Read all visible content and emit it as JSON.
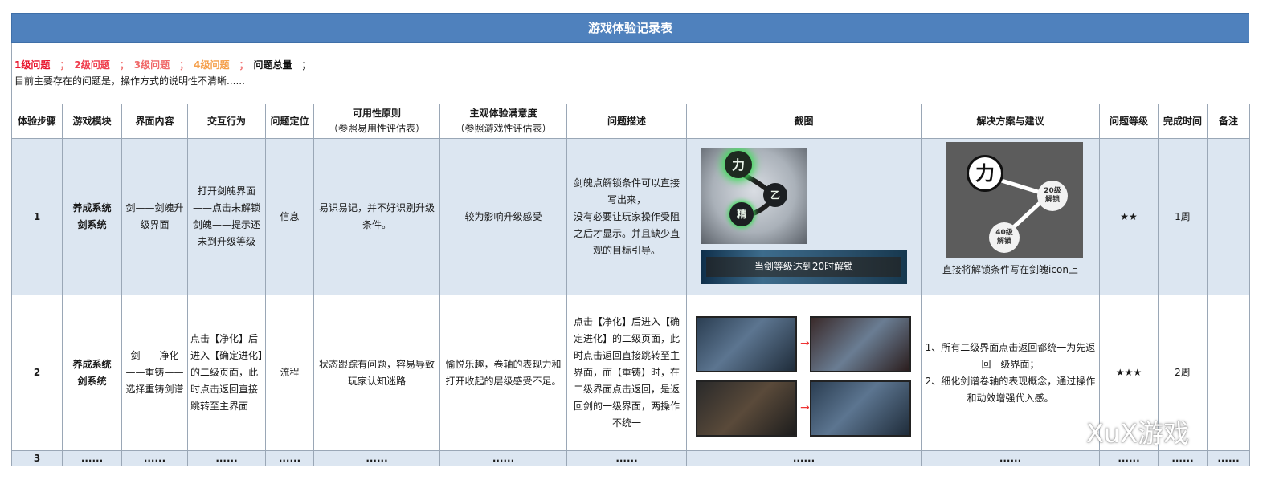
{
  "title": "游戏体验记录表",
  "summary": {
    "level1": "1级问题",
    "level2": "2级问题",
    "level3": "3级问题",
    "level4": "4级问题",
    "separator": "；",
    "total_label": "问题总量",
    "total_end": "；",
    "note": "目前主要存在的问题是，操作方式的说明性不清晰......"
  },
  "headers": {
    "step": "体验步骤",
    "module": "游戏模块",
    "content": "界面内容",
    "action": "交互行为",
    "position": "问题定位",
    "usability": "可用性原则",
    "usability_sub": "（参照易用性评估表）",
    "satisfaction": "主观体验满意度",
    "satisfaction_sub": "（参照游戏性评估表）",
    "description": "问题描述",
    "screenshot": "截图",
    "solution": "解决方案与建议",
    "level": "问题等级",
    "time": "完成时间",
    "remark": "备注"
  },
  "rows": [
    {
      "step": "1",
      "module": "养成系统\n剑系统",
      "content": "剑——剑魄升级界面",
      "action": "打开剑魄界面——点击未解锁剑魄——提示还未到升级等级",
      "position": "信息",
      "usability": "易识易记，并不好识别升级条件。",
      "satisfaction": "较为影响升级感受",
      "description": "剑魄点解锁条件可以直接写出来，\n没有必要让玩家操作受阻之后才显示。并且缺少直观的目标引导。",
      "screenshot_banner": "当剑等级达到20时解锁",
      "screenshot_orbs": [
        "力",
        "乙",
        "精"
      ],
      "solution_caption": "直接将解锁条件写在剑魄icon上",
      "solution_orbs": {
        "main": "力",
        "node1_level": "20级",
        "node1_text": "解锁",
        "node2_level": "40级",
        "node2_text": "解锁"
      },
      "level": "★★",
      "time": "1周",
      "remark": ""
    },
    {
      "step": "2",
      "module": "养成系统\n剑系统",
      "content": "剑——净化——重铸——选择重铸剑谱",
      "action": "点击【净化】后进入【确定进化】的二级页面，此时点击返回直接跳转至主界面",
      "position": "流程",
      "usability": "状态跟踪有问题，容易导致玩家认知迷路",
      "satisfaction": "愉悦乐趣，卷轴的表现力和打开收起的层级感受不足。",
      "description": "点击【净化】后进入【确定进化】的二级页面，此时点击返回直接跳转至主界面，而【重铸】时，在二级界面点击返回，是返回剑的一级界面，两操作不统一",
      "solution": "1、所有二级界面点击返回都统一为先返回一级界面；\n2、细化剑谱卷轴的表现概念，通过操作和动效增强代入感。",
      "level": "★★★",
      "time": "2周",
      "remark": ""
    },
    {
      "step": "3",
      "module": "......",
      "content": "......",
      "action": "......",
      "position": "......",
      "usability": "......",
      "satisfaction": "......",
      "description": "......",
      "screenshot": "......",
      "solution": "......",
      "level": "......",
      "time": "......",
      "remark": "......"
    }
  ],
  "watermark": "XuX游戏",
  "icons": {
    "wechat": "wechat-logo-icon",
    "arrow": "red-arrow-icon"
  }
}
